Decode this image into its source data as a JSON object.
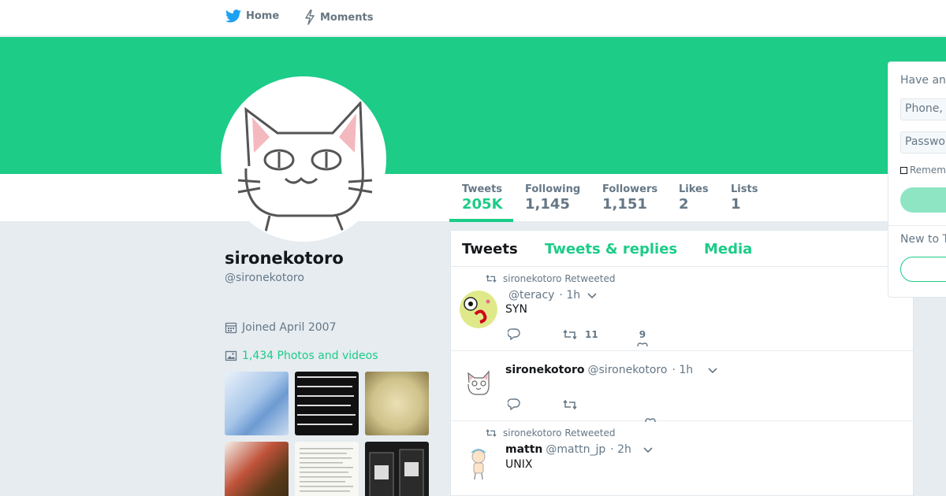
{
  "nav": {
    "home_label": "Home",
    "moments_label": "Moments"
  },
  "colors": {
    "accent": "#1ccc87",
    "banner": "#1ccc87",
    "text_secondary": "#657786"
  },
  "profile": {
    "name": "sironekotoro",
    "handle": "@sironekotoro",
    "joined": "Joined April 2007",
    "photos_label": "1,434 Photos and videos"
  },
  "stats": [
    {
      "label": "Tweets",
      "value": "205K",
      "active": true
    },
    {
      "label": "Following",
      "value": "1,145"
    },
    {
      "label": "Followers",
      "value": "1,151"
    },
    {
      "label": "Likes",
      "value": "2"
    },
    {
      "label": "Lists",
      "value": "1"
    }
  ],
  "tabs": [
    "Tweets",
    "Tweets & replies",
    "Media"
  ],
  "tweets": [
    {
      "retweet_label": "sironekotoro Retweeted",
      "name": "",
      "handle": "@teracy",
      "time": "· 1h",
      "text": "SYN",
      "retweets": "11",
      "likes": "9"
    },
    {
      "retweet_label": "",
      "name": "sironekotoro",
      "handle": "@sironekotoro",
      "time": "· 1h",
      "text": "",
      "retweets": "",
      "likes": ""
    },
    {
      "retweet_label": "sironekotoro Retweeted",
      "name": "mattn",
      "handle": "@mattn_jp",
      "time": "· 2h",
      "text": "UNIX",
      "retweets": "",
      "likes": ""
    }
  ],
  "login": {
    "title": "Have an",
    "phone_placeholder": "Phone,",
    "password_placeholder": "Passwor",
    "remember": "Rememb",
    "new_to": "New to T"
  }
}
